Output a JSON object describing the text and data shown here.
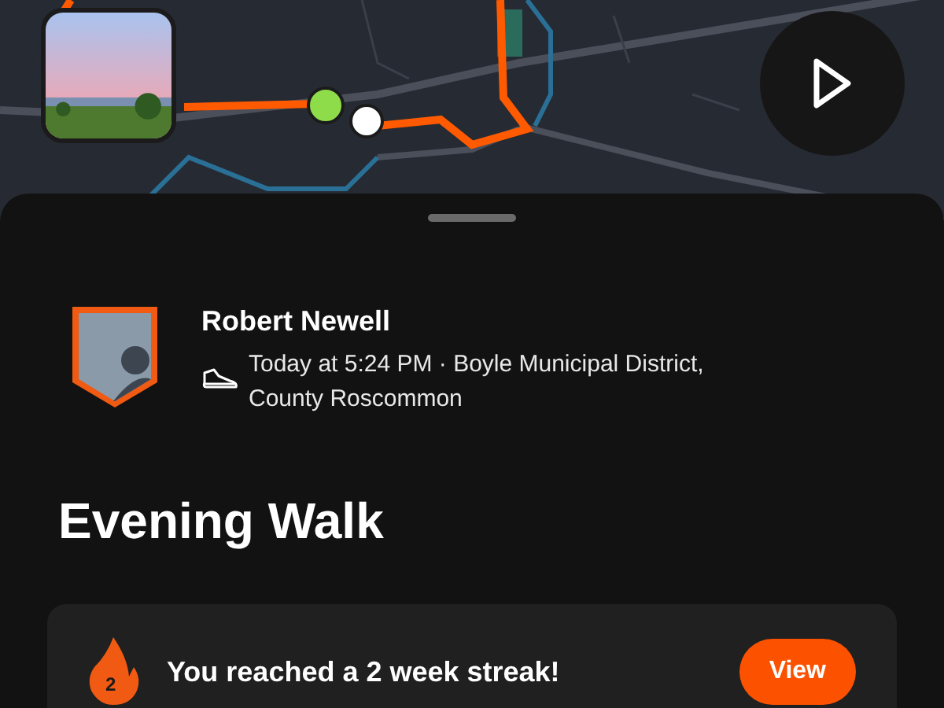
{
  "map": {
    "kind": "picture"
  },
  "athlete": {
    "name": "Robert Newell",
    "activity_line": "Today at 5:24 PM · Boyle Municipal District, County Roscommon"
  },
  "activity": {
    "title": "Evening Walk"
  },
  "streak_card": {
    "badge": "2",
    "message": "You reached a 2 week streak!",
    "button": "View"
  }
}
